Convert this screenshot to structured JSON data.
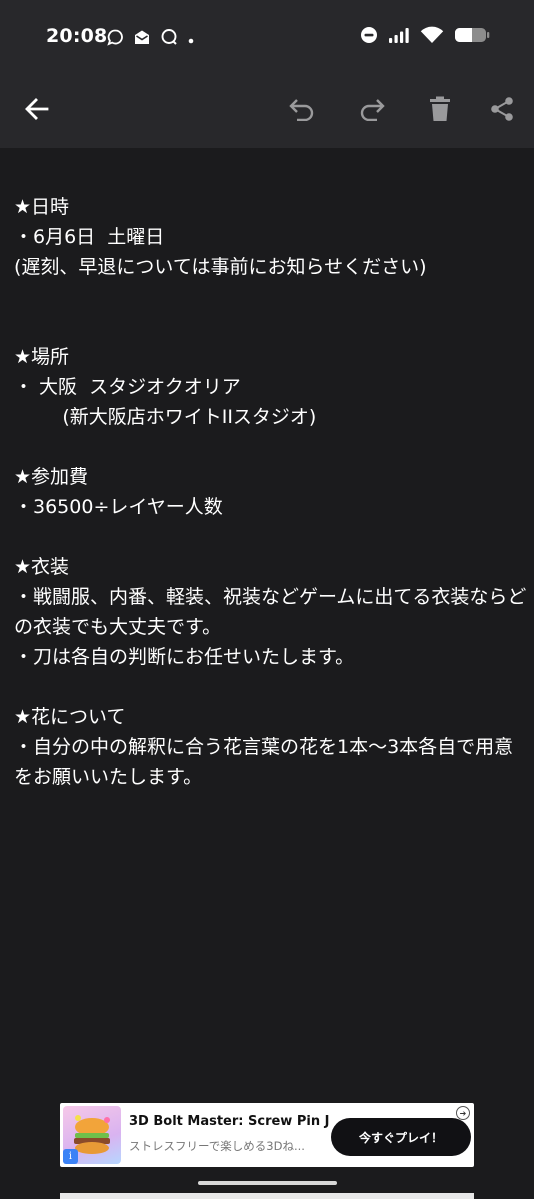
{
  "status_bar": {
    "time": "20:08"
  },
  "toolbar": {
    "icons": [
      "back-arrow-icon",
      "undo-icon",
      "redo-icon",
      "trash-icon",
      "share-icon"
    ]
  },
  "note": {
    "lines": [
      "★日時",
      "・6月6日  土曜日",
      "(遅刻、早退については事前にお知らせください)",
      "",
      "",
      "★場所",
      "・ 大阪  スタジオクオリア",
      "        (新大阪店ホワイトIIスタジオ)",
      "",
      "★参加費",
      "・36500÷レイヤー人数",
      "",
      "★衣装",
      "・戦闘服、内番、軽装、祝装などゲームに出てる衣装ならどの衣装でも大丈夫です。",
      "・刀は各自の判断にお任せいたします。",
      "",
      "★花について",
      "・自分の中の解釈に合う花言葉の花を1本〜3本各自で用意をお願いいたします。"
    ]
  },
  "ad": {
    "title": "3D Bolt Master: Screw Pin J...",
    "subtitle": "ストレスフリーで楽しめる3Dね...",
    "cta": "今すぐプレイ！",
    "info_label": "i"
  },
  "colors": {
    "background": "#1b1b1d",
    "header": "#28282b",
    "text": "#ffffff"
  }
}
